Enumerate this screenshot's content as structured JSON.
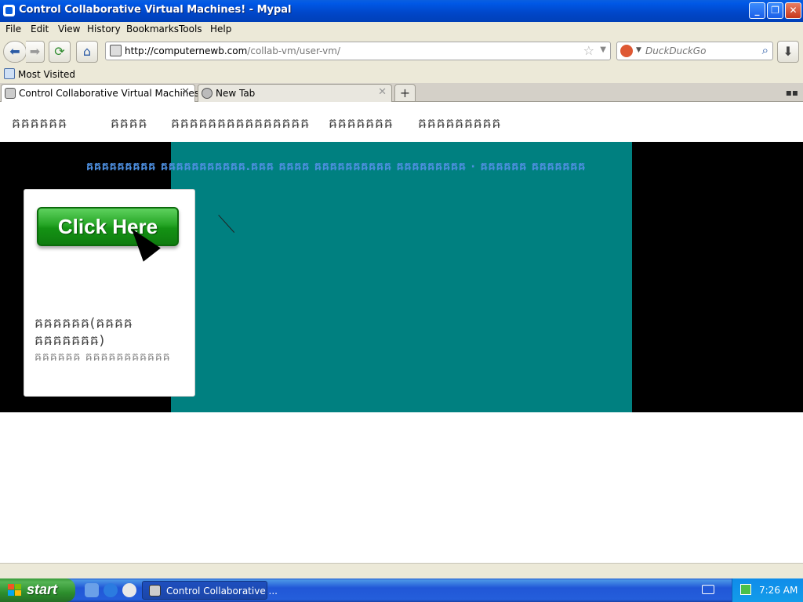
{
  "window": {
    "title": "Control Collaborative Virtual Machines! - Mypal",
    "controls": [
      "_",
      "❐",
      "✕"
    ]
  },
  "menu": [
    "File",
    "Edit",
    "View",
    "History",
    "Bookmarks",
    "Tools",
    "Help"
  ],
  "nav": {
    "url_host": "http://computernewb.com",
    "url_path": "/collab-vm/user-vm/",
    "search_placeholder": "DuckDuckGo"
  },
  "bookmarks": {
    "most_visited": "Most Visited"
  },
  "tabs": [
    {
      "label": "Control Collaborative Virtual Machines!",
      "active": true
    },
    {
      "label": "New Tab",
      "active": false
    }
  ],
  "page": {
    "site_nav": [
      "ឝឝឝឝឝឝ",
      "ឝឝឝឝ",
      "ឝឝឝឝឝឝឝឝឝឝឝឝឝឝឝ",
      "ឝឝឝឝឝឝឝ",
      "ឝឝឝឝឝឝឝឝឝ"
    ],
    "banner": "ឝឝឝឝឝឝឝឝឝ ឝឝឝឝឝឝឝឝឝឝឝ.ឝឝឝ  ឝឝឝឝ ឝឝឝឝឝឝឝឝឝឝ ឝឝឝឝឝឝឝឝឝ · ឝឝឝឝឝឝ ឝឝឝឝឝឝឝ",
    "vm_screen_color": "#008080",
    "click_here": "Click Here",
    "panel_title": "ឝឝឝឝឝឝ(ឝឝឝឝ ឝឝឝឝឝឝឝ)",
    "panel_subtitle": "ឝឝឝឝឝឝ ឝឝឝឝឝឝឝឝឝឝឝ"
  },
  "taskbar": {
    "start": "start",
    "task_label": "Control Collaborative ...",
    "clock": "7:26 AM"
  }
}
